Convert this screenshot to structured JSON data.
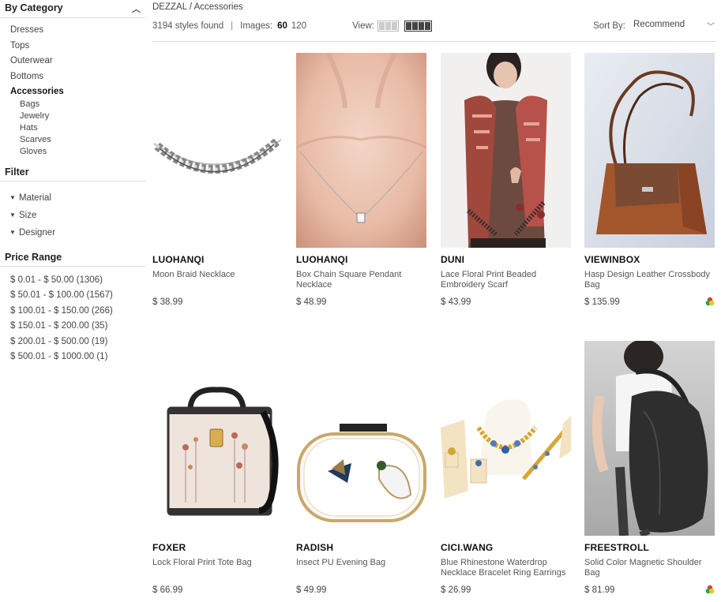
{
  "sidebar": {
    "category_title": "By Category",
    "categories": [
      "Dresses",
      "Tops",
      "Outerwear",
      "Bottoms",
      "Accessories"
    ],
    "subcategories": [
      "Bags",
      "Jewelry",
      "Hats",
      "Scarves",
      "Gloves"
    ],
    "filter_title": "Filter",
    "filters": [
      "Material",
      "Size",
      "Designer"
    ],
    "price_title": "Price Range",
    "prices": [
      "$ 0.01 - $ 50.00 (1306)",
      "$ 50.01 - $ 100.00 (1567)",
      "$ 100.01 - $ 150.00 (266)",
      "$ 150.01 - $ 200.00 (35)",
      "$ 200.01 - $ 500.00 (19)",
      "$ 500.01 - $ 1000.00 (1)"
    ]
  },
  "header": {
    "breadcrumb": "DEZZAL / Accessories",
    "styles_found": "3194 styles found",
    "separator": "|",
    "images_label": "Images:",
    "images_60": "60",
    "images_120": "120",
    "view_label": "View:",
    "sort_label": "Sort By:",
    "sort_value": "Recommend"
  },
  "products": [
    {
      "brand": "LUOHANQI",
      "name": "Moon Braid Necklace",
      "price": "$ 38.99"
    },
    {
      "brand": "LUOHANQI",
      "name": "Box Chain Square Pendant Necklace",
      "price": "$ 48.99"
    },
    {
      "brand": "DUNI",
      "name": "Lace Floral Print Beaded Embroidery Scarf",
      "price": "$ 43.99"
    },
    {
      "brand": "VIEWINBOX",
      "name": "Hasp Design Leather Crossbody Bag",
      "price": "$ 135.99"
    },
    {
      "brand": "FOXER",
      "name": "Lock Floral Print Tote Bag",
      "price": "$ 66.99"
    },
    {
      "brand": "RADISH",
      "name": "Insect PU Evening Bag",
      "price": "$ 49.99"
    },
    {
      "brand": "CICI.WANG",
      "name": "Blue Rhinestone Waterdrop Necklace Bracelet Ring Earrings",
      "price": "$ 26.99"
    },
    {
      "brand": "FREESTROLL",
      "name": "Solid Color Magnetic Shoulder Bag",
      "price": "$ 81.99"
    }
  ],
  "icons": {
    "chevron": "chevron-up-icon",
    "caret": "caret-down-icon",
    "multicolor": "color-options-icon"
  }
}
